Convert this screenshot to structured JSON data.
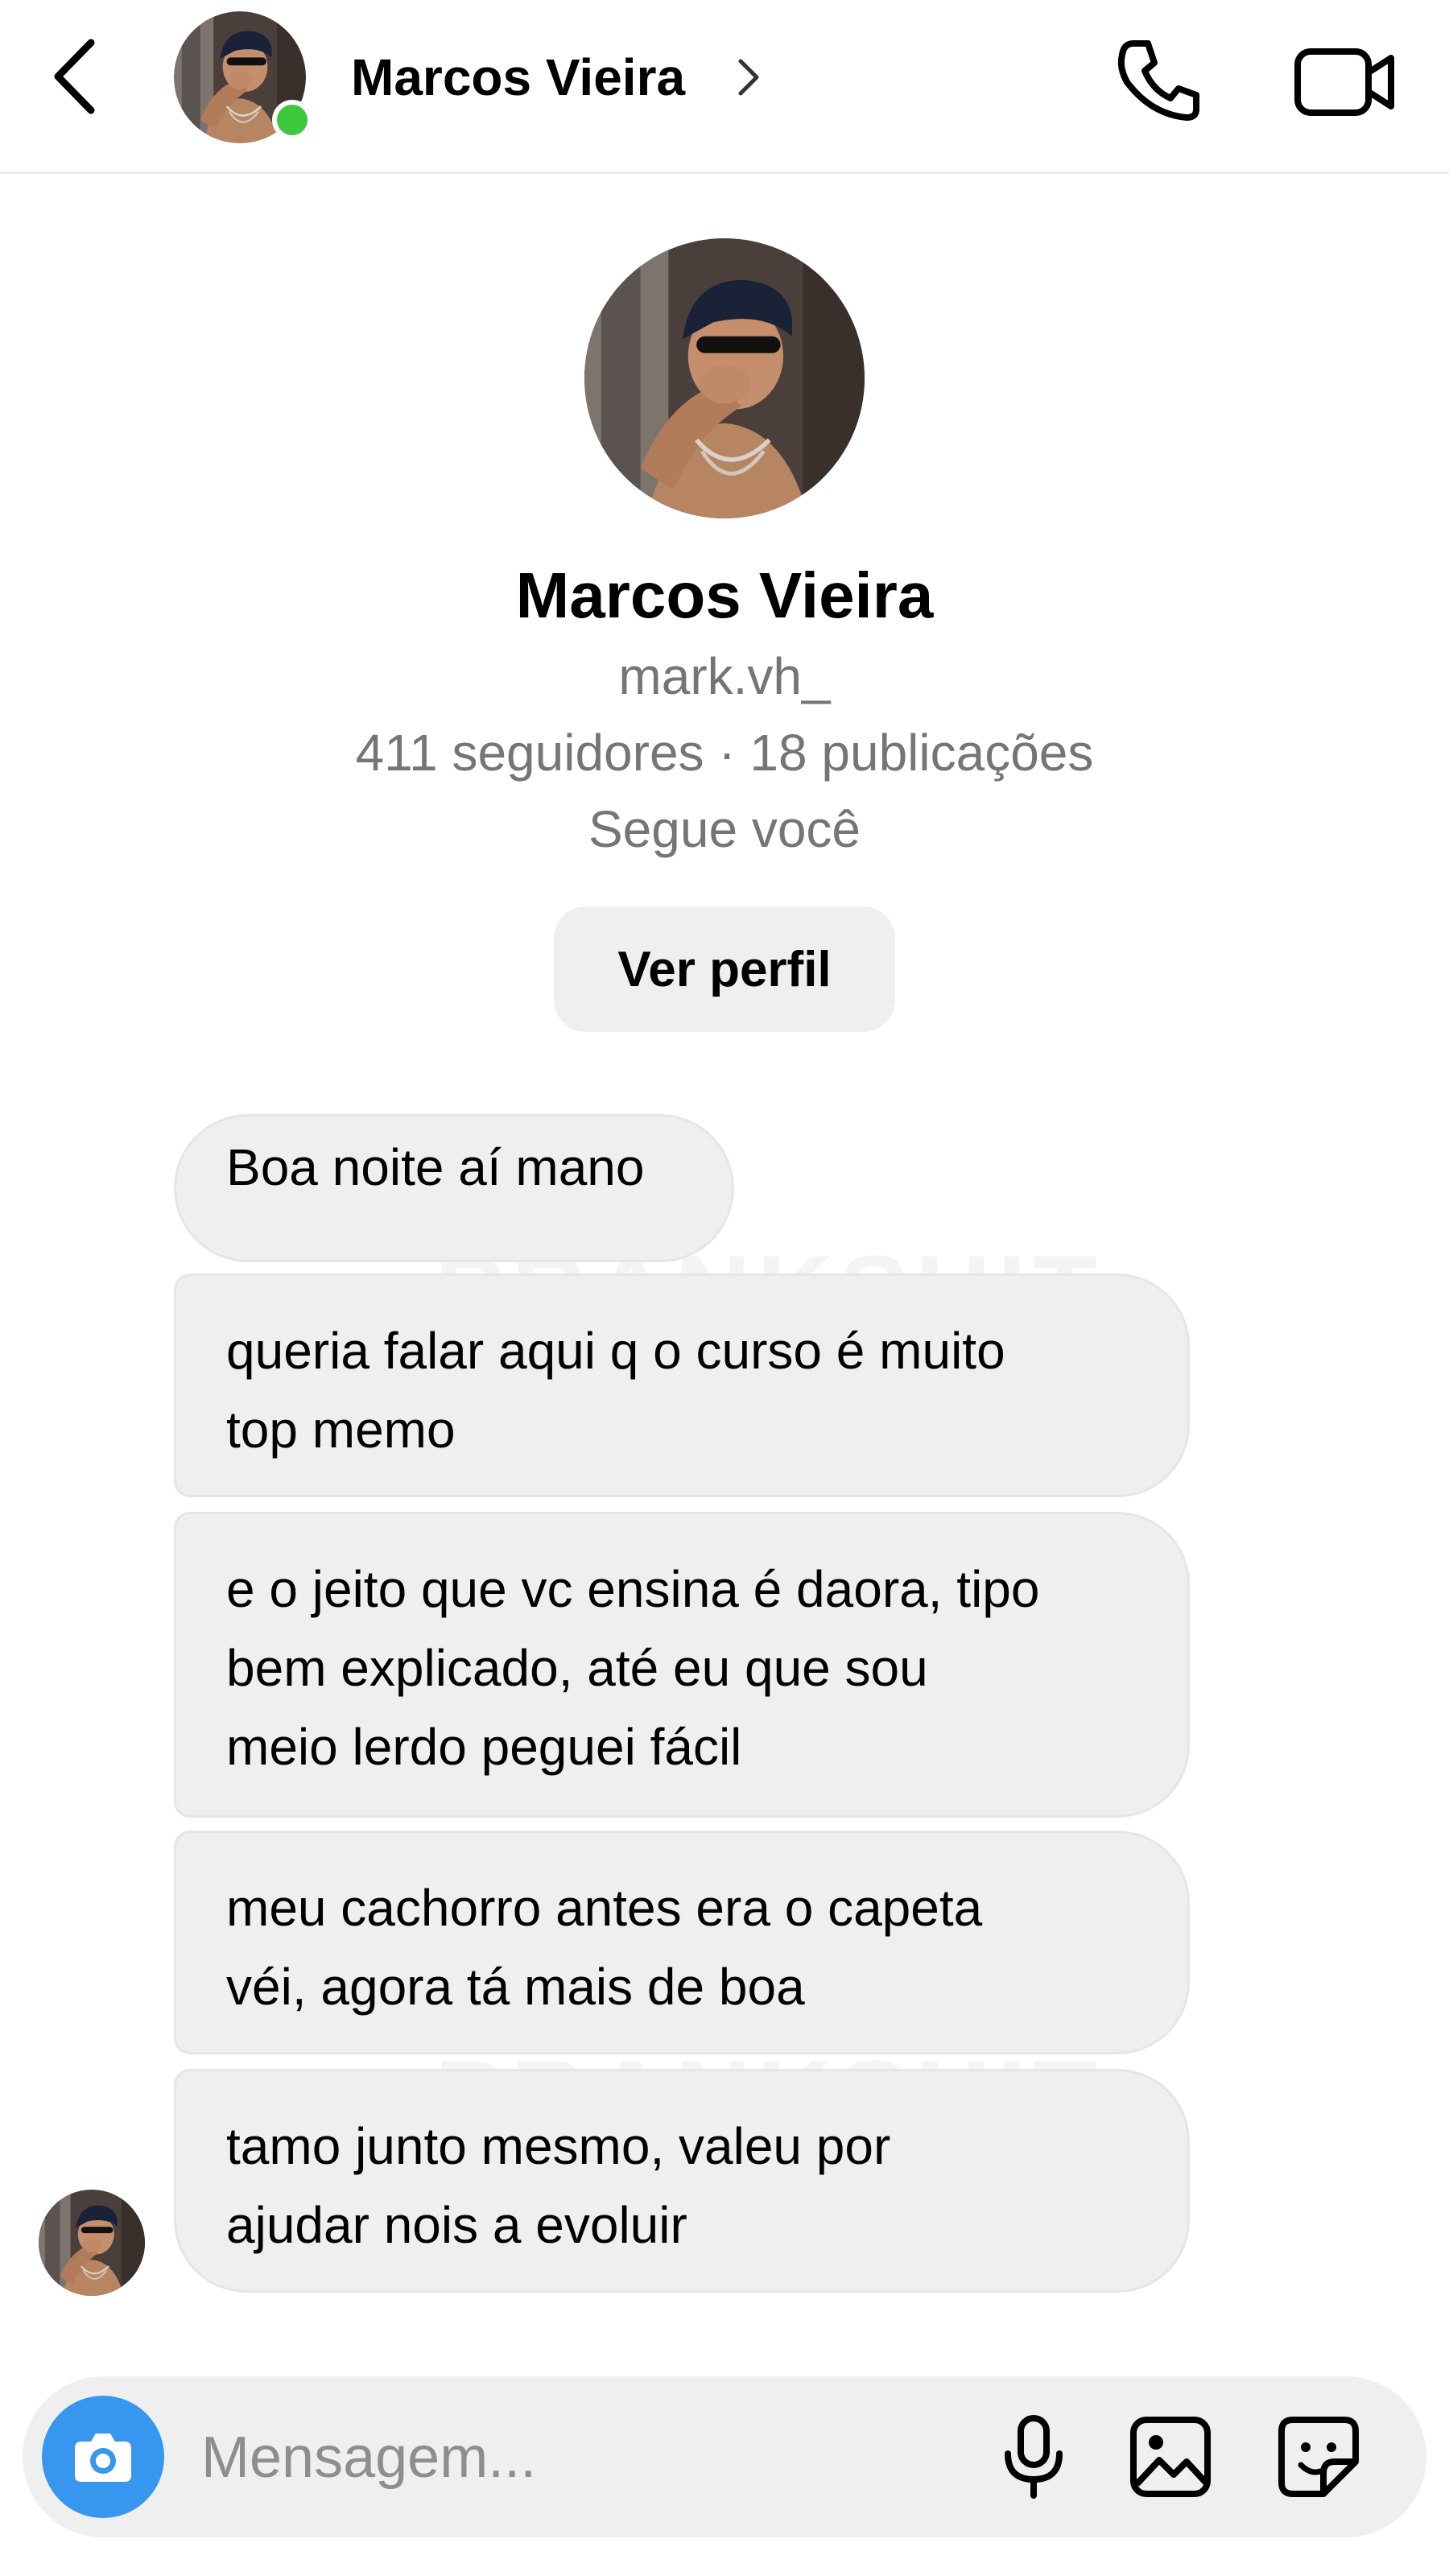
{
  "header": {
    "name": "Marcos Vieira",
    "online": true,
    "icons": {
      "back": "chevron-left-icon",
      "call": "phone-icon",
      "video": "video-camera-icon"
    }
  },
  "profile": {
    "name": "Marcos Vieira",
    "handle": "mark.vh_",
    "stats": "411 seguidores · 18 publicações",
    "follows_you": "Segue você",
    "button_label": "Ver perfil"
  },
  "watermark": "PRANKSHIT",
  "messages": [
    {
      "text": "Boa noite aí mano"
    },
    {
      "text": "queria falar aqui q o curso é muito\ntop memo"
    },
    {
      "text": "e o jeito que vc ensina é daora, tipo\nbem explicado, até eu que sou\nmeio lerdo peguei fácil"
    },
    {
      "text": "meu cachorro antes era o capeta\nvéi, agora tá mais de boa"
    },
    {
      "text": "tamo junto mesmo, valeu por\najudar nois a evoluir"
    }
  ],
  "composer": {
    "placeholder": "Mensagem...",
    "icons": [
      "camera-icon",
      "microphone-icon",
      "gallery-icon",
      "sticker-icon"
    ]
  },
  "colors": {
    "accent": "#3797f0",
    "bubble": "#efefef",
    "online": "#3ec83e",
    "muted_text": "#757575"
  }
}
